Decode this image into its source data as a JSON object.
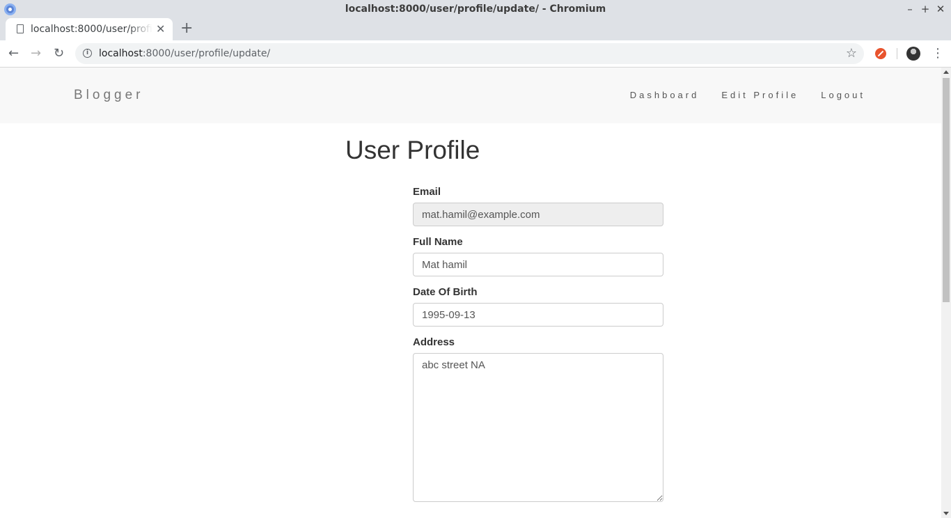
{
  "window": {
    "title": "localhost:8000/user/profile/update/ - Chromium"
  },
  "tab": {
    "title": "localhost:8000/user/profile/update/",
    "close": "✕",
    "new_tab": "+"
  },
  "address_bar": {
    "host": "localhost",
    "rest": ":8000/user/profile/update/"
  },
  "site": {
    "brand": "Blogger",
    "nav": [
      {
        "label": "Dashboard"
      },
      {
        "label": "Edit Profile"
      },
      {
        "label": "Logout"
      }
    ]
  },
  "profile": {
    "heading": "User Profile",
    "email": {
      "label": "Email",
      "value": "mat.hamil@example.com"
    },
    "full_name": {
      "label": "Full Name",
      "value": "Mat hamil"
    },
    "dob": {
      "label": "Date Of Birth",
      "value": "1995-09-13"
    },
    "address": {
      "label": "Address",
      "value": "abc street NA"
    }
  },
  "icons": {
    "back": "back-arrow-icon",
    "forward": "forward-arrow-icon",
    "reload": "reload-icon",
    "info": "info-icon",
    "star": "bookmark-star-icon",
    "menu": "kebab-menu-icon"
  }
}
